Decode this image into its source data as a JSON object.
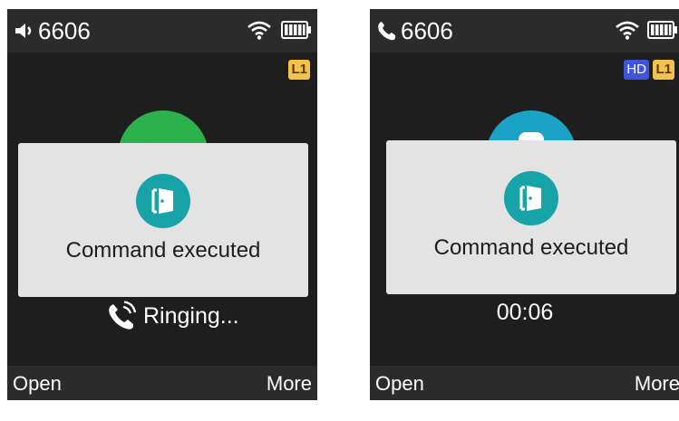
{
  "screens": [
    {
      "ext_number": "6606",
      "status_icon": "speaker-icon",
      "line_badge": "L1",
      "avatar_color": "#2bb24c",
      "overlay": {
        "icon": "door-icon",
        "text": "Command executed"
      },
      "call_status": "Ringing...",
      "call_status_icon": "phone-ringing-icon",
      "softkeys": {
        "left": "Open",
        "right": "More"
      }
    },
    {
      "ext_number": "6606",
      "status_icon": "phone-icon",
      "hd_badge": "HD",
      "line_badge": "L1",
      "avatar_color": "#1aa3c6",
      "overlay": {
        "icon": "door-icon",
        "text": "Command executed"
      },
      "call_status": "00:06",
      "softkeys": {
        "left": "Open",
        "right": "More"
      }
    }
  ],
  "colors": {
    "screen_bg": "#1e1e1e",
    "bar_bg": "#2b2b2b",
    "overlay_bg": "#e3e3e3",
    "door_badge": "#18a3a8",
    "line_badge": "#f3c14d",
    "hd_badge": "#3e55d8"
  }
}
